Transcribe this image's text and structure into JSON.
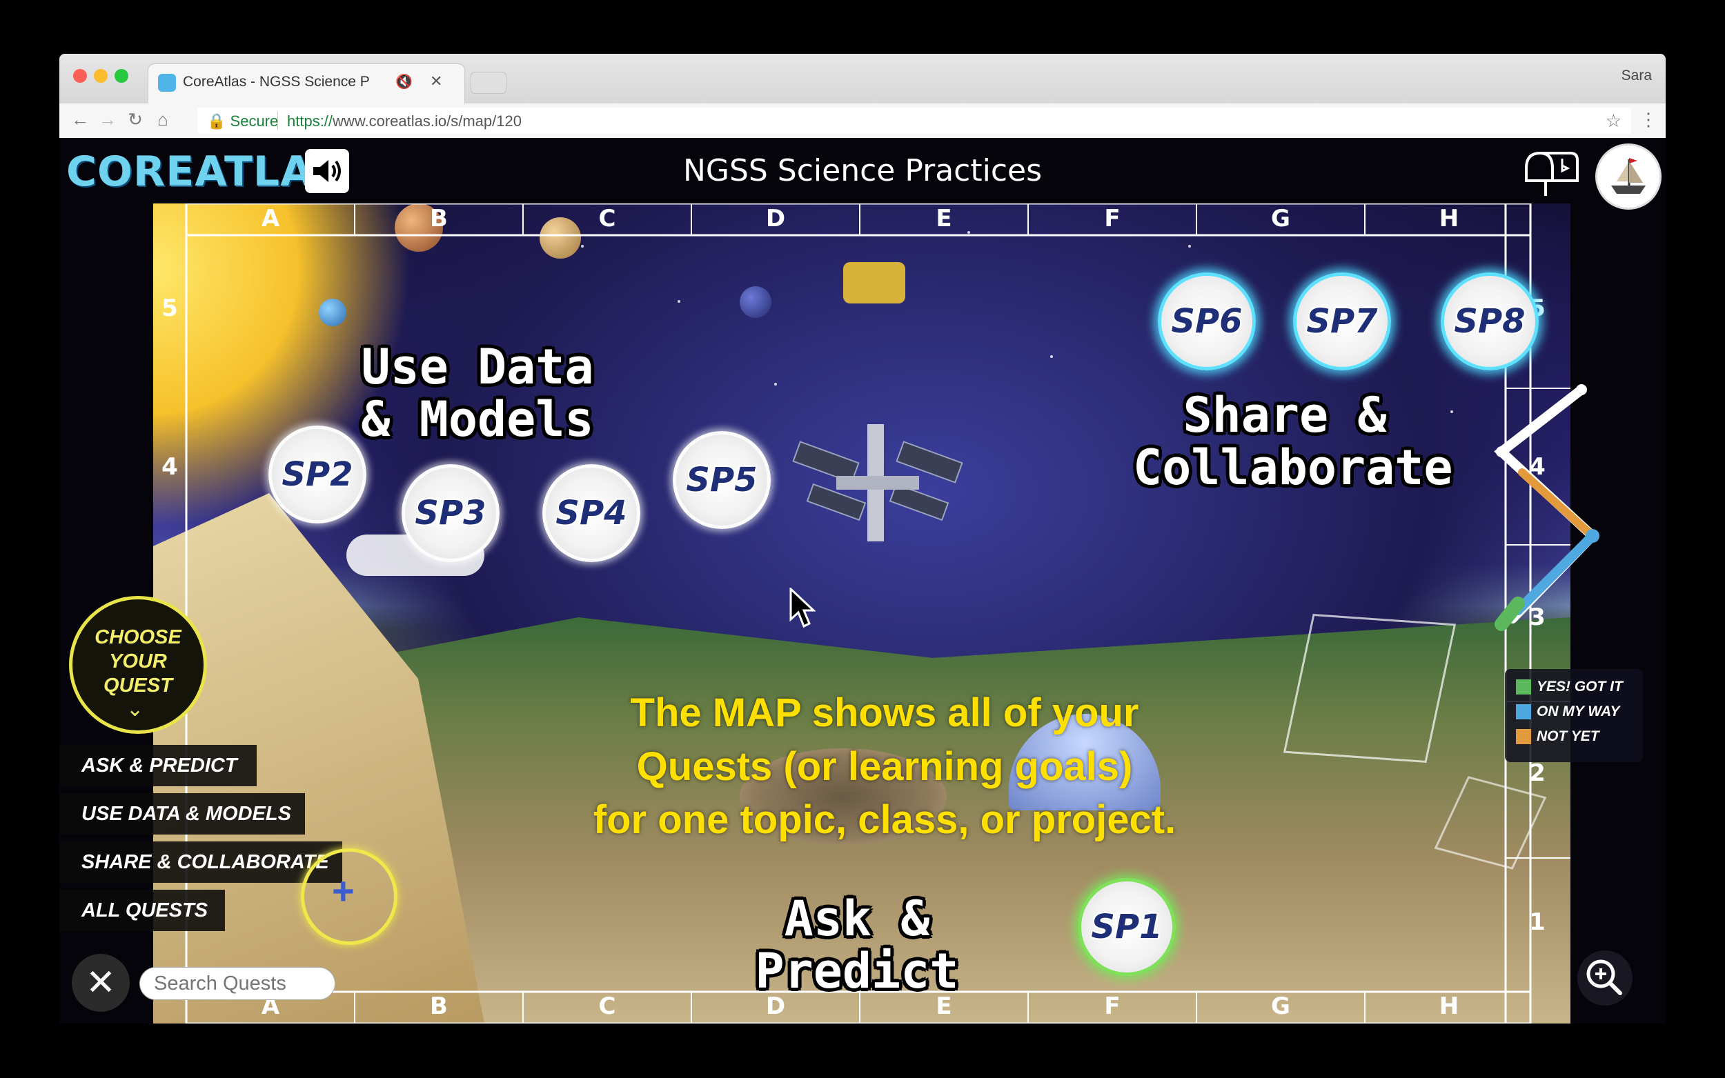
{
  "browser": {
    "tab_title": "CoreAtlas - NGSS Science P",
    "tab_muted_icon": "speaker-icon",
    "profile_name": "Sara",
    "secure_label": "Secure",
    "url_scheme": "https://",
    "url_rest": "www.coreatlas.io/s/map/120"
  },
  "app": {
    "logo": "COREATLAS",
    "page_title": "NGSS Science Practices"
  },
  "map": {
    "columns": [
      "A",
      "B",
      "C",
      "D",
      "E",
      "F",
      "G",
      "H"
    ],
    "rows": [
      "5",
      "4",
      "3",
      "2",
      "1"
    ],
    "headings": {
      "use_data": "Use Data\n& Models",
      "share": "Share &\nCollaborate",
      "ask": "Ask &\nPredict"
    },
    "quests": [
      {
        "id": "SP1",
        "label": "SP1"
      },
      {
        "id": "SP2",
        "label": "SP2"
      },
      {
        "id": "SP3",
        "label": "SP3"
      },
      {
        "id": "SP4",
        "label": "SP4"
      },
      {
        "id": "SP5",
        "label": "SP5"
      },
      {
        "id": "SP6",
        "label": "SP6"
      },
      {
        "id": "SP7",
        "label": "SP7"
      },
      {
        "id": "SP8",
        "label": "SP8"
      }
    ],
    "overlay_text": "The MAP shows all of your\nQuests (or learning goals)\nfor one topic, class, or project."
  },
  "legend": {
    "items": [
      {
        "label": "YES! GOT IT",
        "color": "#5cb85c"
      },
      {
        "label": "ON MY WAY",
        "color": "#4fa8e0"
      },
      {
        "label": "NOT YET",
        "color": "#e39a3c"
      }
    ]
  },
  "panel": {
    "choose_label": "CHOOSE YOUR QUEST",
    "filters": [
      "ASK & PREDICT",
      "USE DATA & MODELS",
      "SHARE & COLLABORATE",
      "ALL QUESTS"
    ],
    "search_placeholder": "Search Quests"
  }
}
